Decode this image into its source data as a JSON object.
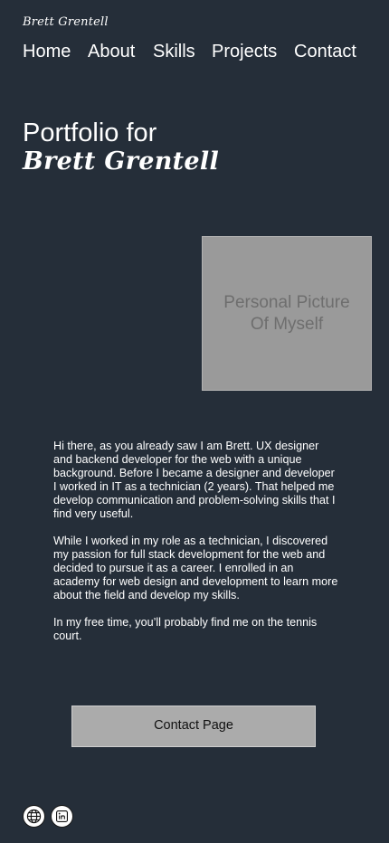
{
  "header": {
    "brand": "Brett Grentell",
    "nav": [
      "Home",
      "About",
      "Skills",
      "Projects",
      "Contact"
    ]
  },
  "hero": {
    "line1": "Portfolio for",
    "line2": "Brett Grentell"
  },
  "photo": {
    "placeholder": "Personal Picture Of Myself"
  },
  "bio": {
    "paragraphs": [
      "Hi there, as you already saw I am Brett.  UX designer and backend developer for the web with a unique background.  Before I became a designer and developer I worked in IT as a technician (2 years). That helped me develop communication and problem-solving skills that I find very useful.",
      "While I worked in my role as a technician, I discovered my passion for full stack development for the web and decided to pursue it as a career.  I enrolled in an academy for web design and development to learn more about the field and develop my skills.",
      "In my free time, you’ll probably find me on the tennis court."
    ]
  },
  "cta": {
    "label": "Contact Page"
  },
  "social": {
    "icons": [
      "globe-icon",
      "linkedin-icon"
    ]
  },
  "colors": {
    "background": "#252e39",
    "placeholder_gray": "#9a9a9a",
    "button_gray": "#ababab"
  }
}
